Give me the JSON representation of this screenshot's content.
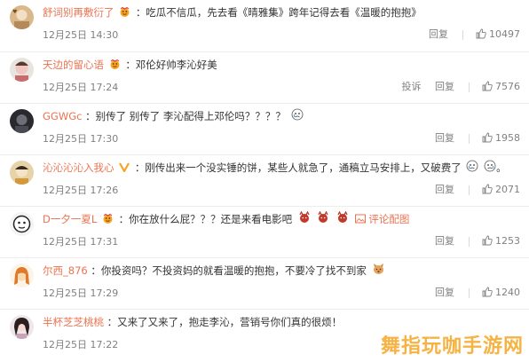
{
  "comments": [
    {
      "user": "舒词别再敷衍了",
      "text": "：吃瓜不信瓜，先去看《晴雅集》跨年记得去看《温暖的抱抱》",
      "time": "12月25日 14:30",
      "actions": [
        "回复"
      ],
      "likes": "10497"
    },
    {
      "user": "天边的留心语",
      "text": "：邓伦好帅李沁好美",
      "time": "12月25日 17:24",
      "actions": [
        "投诉",
        "回复"
      ],
      "likes": "7576"
    },
    {
      "user": "GGWGc",
      "text": "：别传了 别传了 李沁配得上邓伦吗？？？？",
      "time": "12月25日 17:30",
      "actions": [
        "回复"
      ],
      "likes": "1958"
    },
    {
      "user": "沁沁沁沁入我心",
      "text": "：刚传出来一个没实锤的饼，某些人就急了，通稿立马安排上，又破费了",
      "time": "12月25日 17:26",
      "actions": [
        "回复"
      ],
      "likes": "2071"
    },
    {
      "user": "D一夕一夏L",
      "text": "：你在放什么屁？？？还是来看电影吧",
      "link": "评论配图",
      "time": "12月25日 17:31",
      "actions": [
        "回复"
      ],
      "likes": "1253"
    },
    {
      "user": "尔西_876",
      "text": "：你投资吗？不投资妈的就看温暖的抱抱，不要冷了找不到家",
      "time": "12月25日 17:29",
      "actions": [
        "回复"
      ],
      "likes": "1240"
    },
    {
      "user": "半杯芝芝桃桃",
      "text": "：又来了又来了，抱走李沁，营销号你们真的很烦！",
      "time": "12月25日 17:22",
      "actions": [],
      "likes": ""
    }
  ],
  "watermark": "舞指玩咖手游网",
  "colors": {
    "username": "#eb7350",
    "text": "#333333",
    "meta": "#808080",
    "link": "#eb7350",
    "watermark": "#f5a623"
  }
}
